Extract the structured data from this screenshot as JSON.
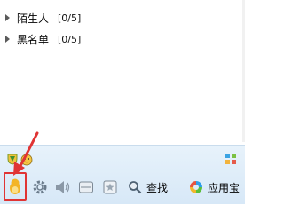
{
  "groups": [
    {
      "name": "陌生人",
      "count": "[0/5]"
    },
    {
      "name": "黑名单",
      "count": "[0/5]"
    }
  ],
  "plugins": {
    "left_icons": [
      "shield-icon",
      "pet-icon"
    ],
    "right_icon": "grid-icon"
  },
  "toolbar": {
    "main_menu_icon": "penguin-icon",
    "settings_icon": "gear-icon",
    "sound_icon": "speaker-icon",
    "message_icon": "message-manager-icon",
    "favorites_icon": "star-icon",
    "search_label": "查找",
    "app_box_label": "应用宝"
  },
  "colors": {
    "highlight": "#e03434",
    "toolbar_bg": "#dcecf8",
    "penguin": "#f3b526"
  }
}
